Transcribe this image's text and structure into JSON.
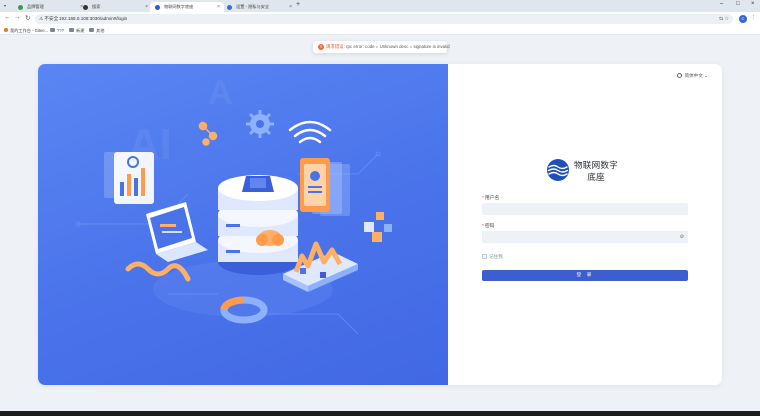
{
  "browser": {
    "tabs": [
      {
        "label": "品牌管理",
        "icon": "app-icon",
        "color": "#3a9b58"
      },
      {
        "label": "搜索",
        "icon": "globe-icon",
        "color": "#333333"
      },
      {
        "label": "物联网数字底座",
        "icon": "site-icon",
        "color": "#2f5bd6"
      },
      {
        "label": "设置 - 隐私与安全",
        "icon": "settings-icon",
        "color": "#3c6bdf"
      }
    ],
    "address": {
      "security": "不安全",
      "url": "192.168.0.108:3030/admin#/login"
    },
    "bookmarks": [
      "我的工作台 - Gitee...",
      "???",
      "新建",
      "其他"
    ],
    "profile_initial": "C"
  },
  "toast": {
    "prefix": "请求错误:",
    "message": "rpc error: code = Unknown desc = signature is invalid"
  },
  "login": {
    "language": "简体中文",
    "brand": "物联网数字底座",
    "username_label": "用户名",
    "username_placeholder": "",
    "password_label": "密码",
    "password_placeholder": "",
    "remember_label": "记住我",
    "submit_label": "登 录"
  },
  "colors": {
    "hero": "#4a73ea",
    "primary_button": "#3d5ecf",
    "toast_error": "#f06b2a"
  }
}
